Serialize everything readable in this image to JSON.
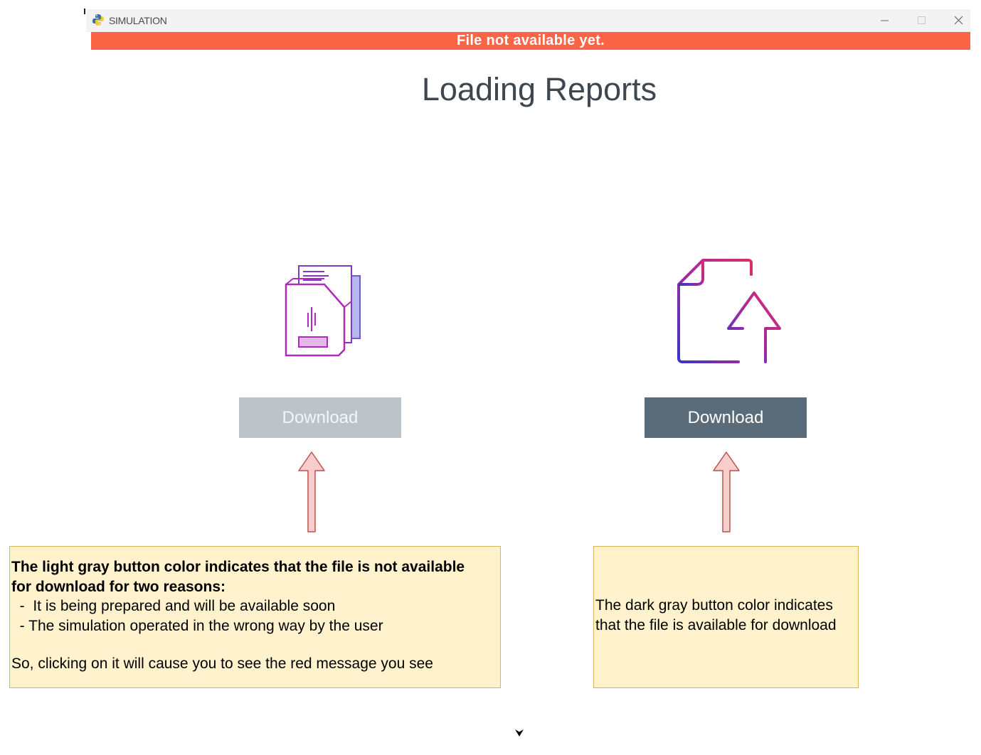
{
  "window": {
    "title": "SIMULATION",
    "app_icon": "python-icon",
    "controls": [
      "minimize-icon",
      "maximize-icon",
      "close-icon"
    ]
  },
  "error_banner": {
    "text": "File not available yet.",
    "color": "#fb6445"
  },
  "page": {
    "title": "Loading Reports"
  },
  "reports": [
    {
      "icon": "documents-icon",
      "button_label": "Download",
      "button_state": "unavailable",
      "button_color": "#bcc4ca"
    },
    {
      "icon": "document-upload-icon",
      "button_label": "Download",
      "button_state": "available",
      "button_color": "#5a6c79"
    }
  ],
  "annotations": {
    "left": {
      "heading_line1": "The light gray button color indicates that the file is not available",
      "heading_line2": "for download for two reasons:",
      "reason1": "  -  It is being prepared and will be available soon",
      "reason2": "  - The simulation operated in the wrong way by the user",
      "footer": "So, clicking on it will cause you to see the red message you see"
    },
    "right": {
      "line1": "The dark gray button color indicates",
      "line2": "that the file is available for download"
    },
    "box_color": "#fff2cc",
    "arrow_color": "#f8cecc"
  }
}
